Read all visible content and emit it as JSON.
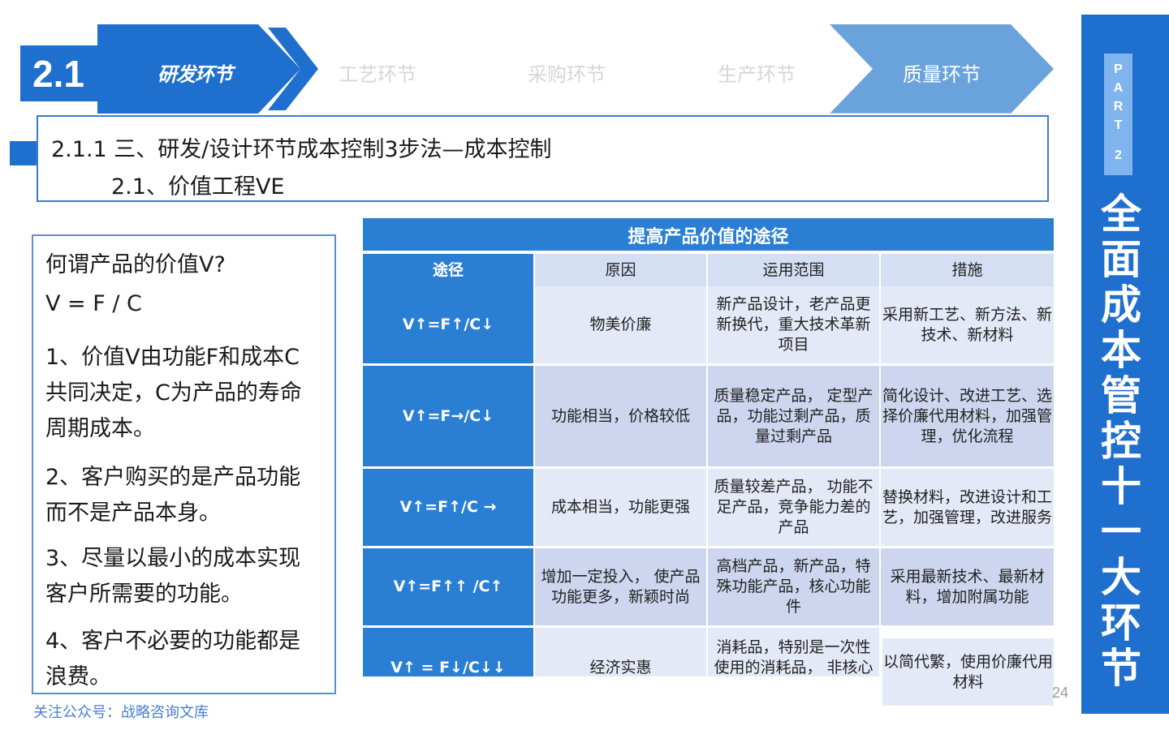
{
  "nav": {
    "section_number": "2.1",
    "steps": [
      "研发环节",
      "工艺环节",
      "采购环节",
      "生产环节",
      "质量环节"
    ]
  },
  "title": {
    "line1": "2.1.1  三、研发/设计环节成本控制3步法—成本控制",
    "line2": "2.1、价值工程VE"
  },
  "left_panel": {
    "question": "何谓产品的价值V?",
    "formula": "V = F / C",
    "points": [
      "1、价值V由功能F和成本C共同决定，C为产品的寿命周期成本。",
      "2、客户购买的是产品功能而不是产品本身。",
      "3、尽量以最小的成本实现客户所需要的功能。",
      "4、客户不必要的功能都是浪费。"
    ]
  },
  "table": {
    "title": "提高产品价值的途径",
    "headers": [
      "途径",
      "原因",
      "运用范围",
      "措施"
    ],
    "rows": [
      [
        "V↑=F↑/C↓",
        "物美价廉",
        "新产品设计，老产品更新换代，重大技术革新项目",
        "采用新工艺、新方法、新技术、新材料"
      ],
      [
        "V↑=F→/C↓",
        "功能相当，价格较低",
        "质量稳定产品， 定型产品，功能过剩产品，质量过剩产品",
        "简化设计、改进工艺、选择价廉代用材料，加强管理，优化流程"
      ],
      [
        "V↑=F↑/C →",
        "成本相当，功能更强",
        "质量较差产品， 功能不足产品，竞争能力差的产品",
        "替换材料，改进设计和工艺，加强管理，改进服务"
      ],
      [
        "V↑=F↑↑ /C↑",
        "增加一定投入， 使产品功能更多，新颖时尚",
        "高档产品，新产品，特殊功能产品，核心功能件",
        "采用最新技术、最新材料，增加附属功能"
      ],
      [
        "V↑ = F↓/C↓↓",
        "经济实惠",
        "消耗品，特别是一次性使用的消耗品， 非核心",
        "以简代繁，使用价廉代用材料"
      ]
    ]
  },
  "page_number": "24",
  "footer": "关注公众号：战略咨询文库",
  "banner": {
    "part": [
      "P",
      "A",
      "R",
      "T",
      "2"
    ],
    "title_chars": [
      "全",
      "面",
      "成",
      "本",
      "管",
      "控",
      "十",
      "一",
      "大",
      "环",
      "节"
    ]
  },
  "colors": {
    "primary_blue": "#1f6fcf",
    "table_blue": "#2a7fd4",
    "active_step": "#6aa3dc",
    "inactive_step_text": "#d6d6d6"
  }
}
